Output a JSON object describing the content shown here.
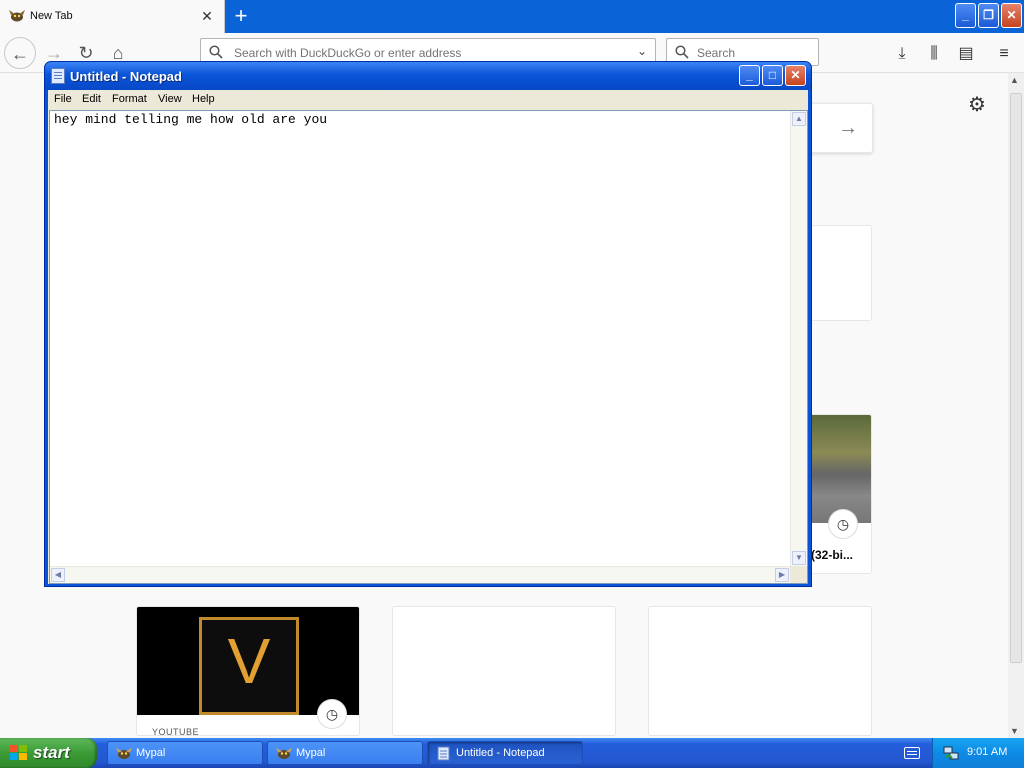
{
  "browser": {
    "tab": {
      "title": "New Tab",
      "close_glyph": "✕"
    },
    "new_tab_glyph": "+",
    "window_controls": {
      "minimize": "_",
      "restore": "❐",
      "close": "✕"
    },
    "nav": {
      "back": "←",
      "forward": "→",
      "reload": "↻",
      "home": "⌂"
    },
    "urlbar": {
      "placeholder": "Search with DuckDuckGo or enter address",
      "dropdown_glyph": "⌄"
    },
    "searchbar": {
      "placeholder": "Search"
    },
    "toolbar_icons": [
      "download-icon",
      "library-icon",
      "sidebar-icon",
      "menu-icon"
    ],
    "toolbar_glyphs": {
      "download": "⤓",
      "library": "⫼",
      "sidebar": "▤",
      "menu": "≡"
    }
  },
  "newtab": {
    "settings_glyph": "⚙",
    "search_go_glyph": "→",
    "video_card": {
      "title": "(32-bi...",
      "clock_glyph": "◷"
    },
    "youtube_card": {
      "logo_letter": "V",
      "label": "YOUTUBE",
      "clock_glyph": "◷"
    },
    "colors": {
      "logo_gold": "#e1a031"
    }
  },
  "notepad": {
    "title": "Untitled - Notepad",
    "controls": {
      "minimize": "_",
      "maximize": "□",
      "close": "✕"
    },
    "menu": [
      "File",
      "Edit",
      "Format",
      "View",
      "Help"
    ],
    "content": "hey mind telling me how old are you"
  },
  "taskbar": {
    "start_label": "start",
    "tasks": [
      {
        "label": "Mypal",
        "icon": "mypal-icon"
      },
      {
        "label": "Mypal",
        "icon": "mypal-icon"
      },
      {
        "label": "Untitled - Notepad",
        "icon": "notepad-icon",
        "active": true
      }
    ],
    "clock": "9:01 AM"
  }
}
